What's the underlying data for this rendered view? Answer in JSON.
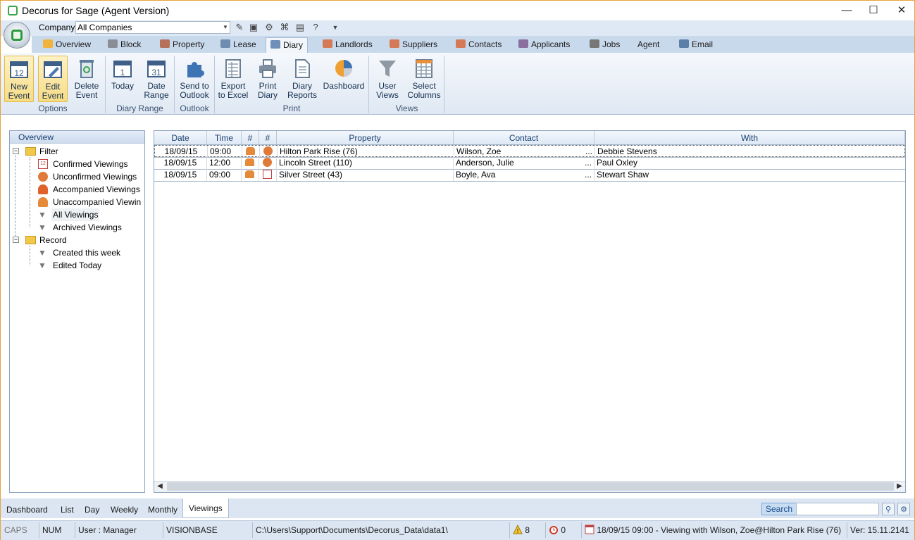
{
  "window": {
    "title": "Decorus for Sage (Agent Version)",
    "minimize": "—",
    "maximize": "☐",
    "close": "✕"
  },
  "toolbar": {
    "company_label": "Company",
    "company_value": "All Companies"
  },
  "tabs": [
    {
      "label": "Overview"
    },
    {
      "label": "Block"
    },
    {
      "label": "Property"
    },
    {
      "label": "Lease"
    },
    {
      "label": "Diary"
    },
    {
      "label": "Landlords"
    },
    {
      "label": "Suppliers"
    },
    {
      "label": "Contacts"
    },
    {
      "label": "Applicants"
    },
    {
      "label": "Jobs"
    },
    {
      "label": "Agent"
    },
    {
      "label": "Email"
    }
  ],
  "ribbon": {
    "buttons": [
      {
        "l1": "New",
        "l2": "Event"
      },
      {
        "l1": "Edit",
        "l2": "Event"
      },
      {
        "l1": "Delete",
        "l2": "Event"
      },
      {
        "l1": "Today",
        "l2": ""
      },
      {
        "l1": "Date",
        "l2": "Range"
      },
      {
        "l1": "Send to",
        "l2": "Outlook"
      },
      {
        "l1": "Export",
        "l2": "to Excel"
      },
      {
        "l1": "Print",
        "l2": "Diary"
      },
      {
        "l1": "Diary",
        "l2": "Reports"
      },
      {
        "l1": "Dashboard",
        "l2": ""
      },
      {
        "l1": "User",
        "l2": "Views"
      },
      {
        "l1": "Select",
        "l2": "Columns"
      }
    ],
    "groups": [
      "Options",
      "Diary Range",
      "Outlook",
      "Print",
      "Views"
    ]
  },
  "overview": {
    "header": "Overview",
    "filter_label": "Filter",
    "filter_items": [
      "Confirmed Viewings",
      "Unconfirmed  Viewings",
      "Accompanied Viewings",
      "Unaccompanied Viewin",
      "All Viewings",
      "Archived Viewings"
    ],
    "record_label": "Record",
    "record_items": [
      "Created this week",
      "Edited Today"
    ]
  },
  "grid": {
    "columns": [
      "Date",
      "Time",
      "#",
      "#",
      "Property",
      "Contact",
      "With"
    ],
    "rows": [
      {
        "date": "18/09/15",
        "time": "09:00",
        "property": "Hilton Park Rise (76)",
        "contact": "Wilson, Zoe",
        "more": "...",
        "with": "Debbie Stevens"
      },
      {
        "date": "18/09/15",
        "time": "12:00",
        "property": "Lincoln Street (110)",
        "contact": "Anderson, Julie",
        "more": "...",
        "with": "Paul Oxley"
      },
      {
        "date": "18/09/15",
        "time": "09:00",
        "property": "Silver Street (43)",
        "contact": "Boyle, Ava",
        "more": "...",
        "with": "Stewart Shaw"
      }
    ]
  },
  "bottom_tabs": [
    "Dashboard",
    "List",
    "Day",
    "Weekly",
    "Monthly",
    "Viewings"
  ],
  "search_label": "Search",
  "status": {
    "caps": "CAPS",
    "num": "NUM",
    "user": "User : Manager",
    "db": "VISIONBASE",
    "path": "C:\\Users\\Support\\Documents\\Decorus_Data\\data1\\",
    "warnings": "8",
    "alarms": "0",
    "event": "18/09/15 09:00 - Viewing with Wilson, Zoe@Hilton Park Rise (76)",
    "version": "Ver: 15.11.2141"
  },
  "colors": {
    "accent": "#1a3f6e",
    "ribbon_active": "#f7dc85",
    "frame": "#e8a33c"
  }
}
